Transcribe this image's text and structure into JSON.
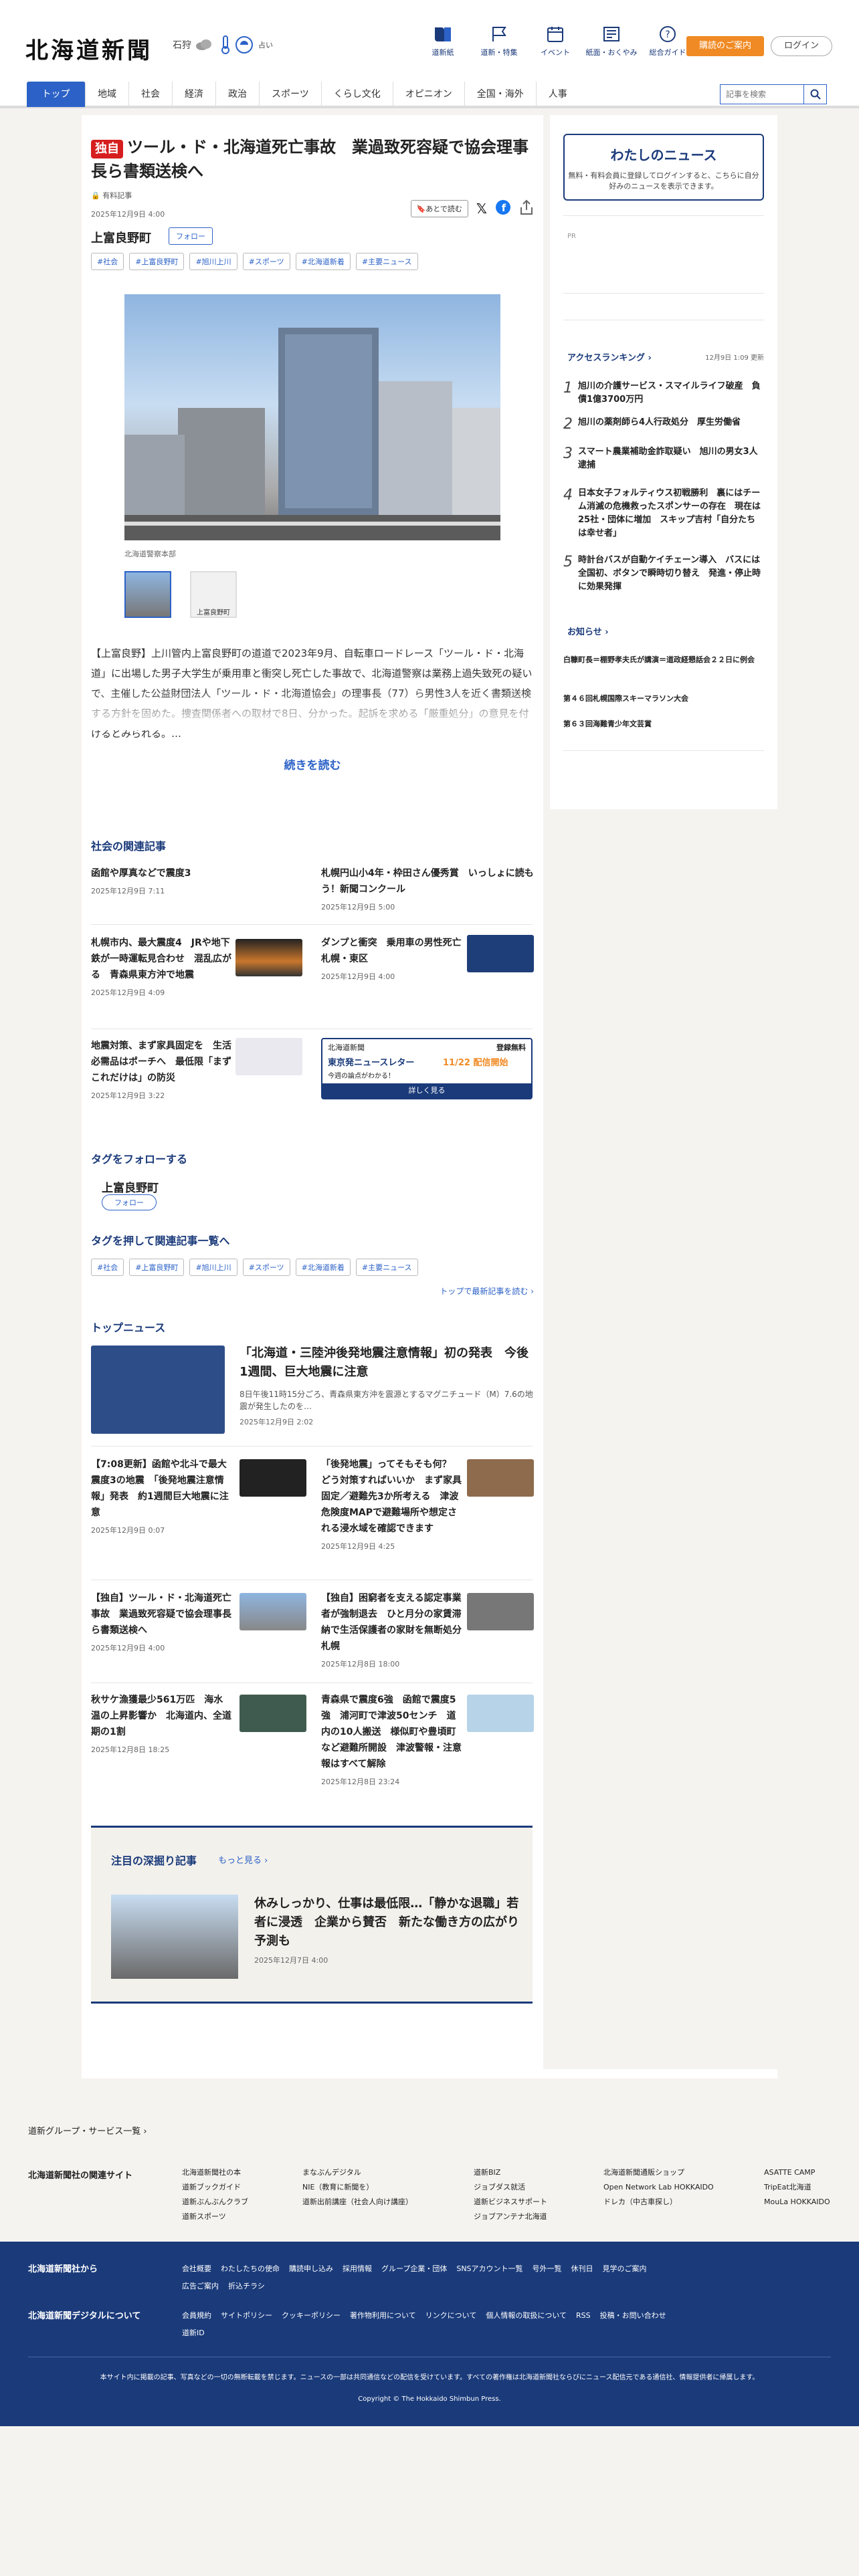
{
  "header": {
    "logo": "北海道新聞",
    "weather": {
      "place": "石狩",
      "temps": [
        "",
        ""
      ],
      "aqi": "占い"
    },
    "nav": [
      {
        "label": "道新紙",
        "icon": "book-icon"
      },
      {
        "label": "道新・特集",
        "icon": "flag-icon"
      },
      {
        "label": "イベント",
        "icon": "calendar-icon"
      },
      {
        "label": "紙面・おくやみ",
        "icon": "newspaper-icon"
      },
      {
        "label": "総合ガイド",
        "icon": "help-icon"
      }
    ],
    "subscribe": "購読のご案内",
    "login": "ログイン",
    "gnav": [
      "トップ",
      "地域",
      "社会",
      "経済",
      "政治",
      "スポーツ",
      "くらし文化",
      "オピニオン",
      "全国・海外",
      "人事"
    ],
    "search_placeholder": "記事を検索"
  },
  "article": {
    "badge": "独自",
    "title": "ツール・ド・北海道死亡事故　業過致死容疑で協会理事長ら書類送検へ",
    "sub": "有料記事",
    "date": "2025年12月9日 4:00",
    "later": "あとで読む",
    "location": "上富良野町",
    "follow": "フォロー",
    "tags": [
      "#社会",
      "#上富良野町",
      "#旭川上川",
      "#スポーツ",
      "#北海道新着",
      "#主要ニュース"
    ],
    "caption": "北海道警察本部",
    "thumb2": "上富良野町",
    "body": "【上富良野】上川管内上富良野町の道道で2023年9月、自転車ロードレース「ツール・ド・北海道」に出場した男子大学生が乗用車と衝突し死亡した事故で、北海道警察は業務上過失致死の疑いで、主催した公益財団法人「ツール・ド・北海道協会」の理事長（77）ら男性3人を近く書類送検する方針を固めた。捜査関係者への取材で8日、分かった。起訴を求める「厳重処分」の意見を付けるとみられる。…",
    "more": "続きを読む"
  },
  "related": {
    "heading": "社会の関連記事",
    "items": [
      {
        "title": "函館や厚真などで震度3",
        "date": "2025年12月9日 7:11"
      },
      {
        "title": "札幌円山小4年・枠田さん優秀賞　いっしょに読もう！新聞コンクール",
        "date": "2025年12月9日 5:00"
      },
      {
        "title": "札幌市内、最大震度4　JRや地下鉄が一時運転見合わせ　混乱広がる　青森県東方沖で地震",
        "date": "2025年12月9日 4:09"
      },
      {
        "title": "ダンプと衝突　乗用車の男性死亡　札幌・東区",
        "date": "2025年12月9日 4:00"
      },
      {
        "title": "地震対策、まず家具固定を　生活必需品はポーチへ　最低限「まずこれだけは」の防災",
        "date": "2025年12月9日 3:22"
      }
    ],
    "ad": {
      "brand": "北海道新聞",
      "free": "登録無料",
      "title": "東京発ニュースレター",
      "date": "11/22 配信開始",
      "sub": "今週の論点がわかる！",
      "btn": "詳しく見る"
    }
  },
  "follow_tags": {
    "heading": "タグをフォローする",
    "name": "上富良野町",
    "btn": "フォロー"
  },
  "tag_related": {
    "heading": "タグを押して関連記事一覧へ",
    "tags": [
      "#社会",
      "#上富良野町",
      "#旭川上川",
      "#スポーツ",
      "#北海道新着",
      "#主要ニュース"
    ],
    "more": "トップで最新記事を読む"
  },
  "top_news": {
    "heading": "トップニュース",
    "lead": {
      "title": "「北海道・三陸沖後発地震注意情報」初の発表　今後1週間、巨大地震に注意",
      "desc": "8日午後11時15分ごろ、青森県東方沖を震源とするマグニチュード（M）7.6の地震が発生したのを…",
      "date": "2025年12月9日 2:02"
    },
    "items": [
      {
        "title": "【7:08更新】函館や北斗で最大震度3の地震　「後発地震注意情報」発表　約1週間巨大地震に注意",
        "date": "2025年12月9日 0:07"
      },
      {
        "title": "「後発地震」ってそもそも何？　どう対策すればいいか　まず家具固定／避難先3か所考える　津波危険度MAPで避難場所や想定される浸水域を確認できます",
        "date": "2025年12月9日 4:25"
      },
      {
        "title": "【独自】ツール・ド・北海道死亡事故　業過致死容疑で協会理事長ら書類送検へ",
        "date": "2025年12月9日 4:00"
      },
      {
        "title": "【独自】困窮者を支える認定事業者が強制退去　ひと月分の家賃滞納で生活保護者の家財を無断処分　札幌",
        "date": "2025年12月8日 18:00"
      },
      {
        "title": "秋サケ漁獲最少561万匹　海水温の上昇影響か　北海道内、全道期の1割",
        "date": "2025年12月8日 18:25"
      },
      {
        "title": "青森県で震度6強　函館で震度5強　浦河町で津波50センチ　道内の10人搬送　様似町や豊頃町など避難所開設　津波警報・注意報はすべて解除",
        "date": "2025年12月8日 23:24"
      }
    ]
  },
  "deep": {
    "heading": "注目の深掘り記事",
    "more": "もっと見る",
    "title": "休みしっかり、仕事は最低限…「静かな退職」若者に浸透　企業から賛否　新たな働き方の広がり予測も",
    "date": "2025年12月7日 4:00"
  },
  "sidebar": {
    "mynews_title": "わたしのニュース",
    "mynews_text": "無料・有料会員に登録してログインすると、こちらに自分好みのニュースを表示できます。",
    "pr": "PR",
    "ranking_heading": "アクセスランキング",
    "ranking_date": "12月9日 1:09 更新",
    "ranking": [
      "旭川の介護サービス・スマイルライフ破産　負債1億3700万円",
      "旭川の薬剤師ら4人行政処分　厚生労働省",
      "スマート農業補助金詐取疑い　旭川の男女3人逮捕",
      "日本女子フォルティウス初戦勝利　裏にはチーム消滅の危機救ったスポンサーの存在　現在は25社・団体に増加　スキップ吉村「自分たちは幸せ者」",
      "時計台バスが自動ケイチェーン導入　バスには全国初、ボタンで瞬時切り替え　発進・停止時に効果発揮"
    ],
    "notice_heading": "お知らせ",
    "notices": [
      "白糠町長＝棚野孝夫氏が講演＝道政経懇話会２２日に例会",
      "第４６回札幌国際スキーマラソン大会",
      "第６３回海難青少年文芸賞"
    ]
  },
  "footer": {
    "group_link": "道新グループ・サービス一覧",
    "related_label": "北海道新聞社の関連サイト",
    "sites": [
      [
        "北海道新聞社の本",
        "道新ブックガイド",
        "道新ぶんぶんクラブ",
        "道新スポーツ"
      ],
      [
        "まなぶんデジタル",
        "NIE（教育に新聞を）",
        "道新出前講座（社会人向け講座）"
      ],
      [
        "道新BIZ",
        "ジョブダス就活",
        "道新ビジネスサポート",
        "ジョブアンテナ北海道"
      ],
      [
        "北海道新聞通販ショップ",
        "Open Network Lab HOKKAIDO",
        "ドレカ（中古車探し）"
      ],
      [
        "ASATTE CAMP",
        "TripEat北海道",
        "MouLa HOKKAIDO"
      ]
    ],
    "from_label": "北海道新聞社から",
    "from_links": [
      "会社概要",
      "わたしたちの使命",
      "購読申し込み",
      "採用情報",
      "グループ企業・団体",
      "SNSアカウント一覧",
      "号外一覧",
      "休刊日",
      "見学のご案内",
      "広告ご案内",
      "折込チラシ"
    ],
    "digital_label": "北海道新聞デジタルについて",
    "digital_links": [
      "会員規約",
      "サイトポリシー",
      "クッキーポリシー",
      "著作物利用について",
      "リンクについて",
      "個人情報の取扱について",
      "RSS",
      "投稿・お問い合わせ",
      "道新ID"
    ],
    "notice": "本サイト内に掲載の記事、写真などの一切の無断転載を禁じます。ニュースの一部は共同通信などの配信を受けています。すべての著作権は北海道新聞社ならびにニュース配信元である通信社、情報提供者に帰属します。",
    "copyright": "Copyright © The Hokkaido Shimbun Press."
  }
}
